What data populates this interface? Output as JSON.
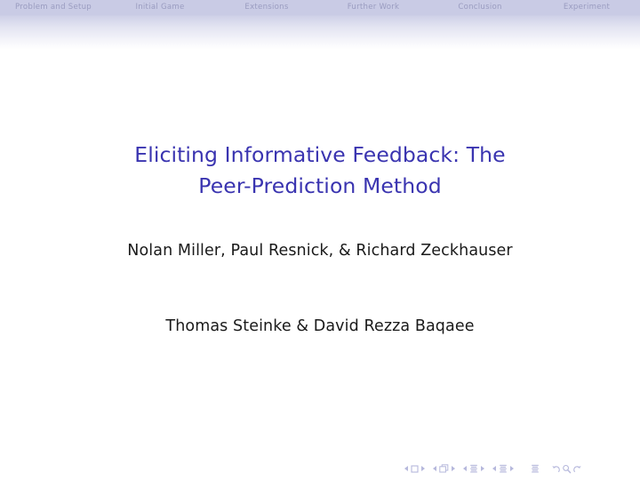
{
  "header": {
    "nav_items": [
      {
        "label": "Problem and Setup"
      },
      {
        "label": "Initial Game"
      },
      {
        "label": "Extensions"
      },
      {
        "label": "Further Work"
      },
      {
        "label": "Conclusion"
      },
      {
        "label": "Experiment"
      }
    ]
  },
  "title": {
    "line1": "Eliciting Informative Feedback: The",
    "line2": "Peer-Prediction Method"
  },
  "authors": {
    "original_authors": "Nolan Miller, Paul Resnick, & Richard Zeckhauser",
    "presenters": "Thomas Steinke & David Rezza Baqaee"
  },
  "navigation_symbols": {
    "slide_prev": "prev-slide",
    "slide_icon": "slide-icon",
    "slide_next": "next-slide",
    "frame_prev": "prev-frame",
    "frame_icon": "frame-icon",
    "frame_next": "next-frame",
    "subsection_prev": "prev-subsection",
    "subsection_icon": "subsection-icon",
    "subsection_next": "next-subsection",
    "section_prev": "prev-section",
    "section_icon": "section-icon",
    "section_next": "next-section",
    "presentation_icon": "presentation-icon",
    "back_icon": "back-icon",
    "search_icon": "search-icon",
    "forward_icon": "forward-icon"
  },
  "colors": {
    "title_blue": "#3a34b0",
    "header_lavender": "#c9cbe5",
    "nav_text": "#9a9cc0",
    "navsym": "#b6b8dc",
    "body_text": "#1a1a1a",
    "background": "#ffffff"
  }
}
